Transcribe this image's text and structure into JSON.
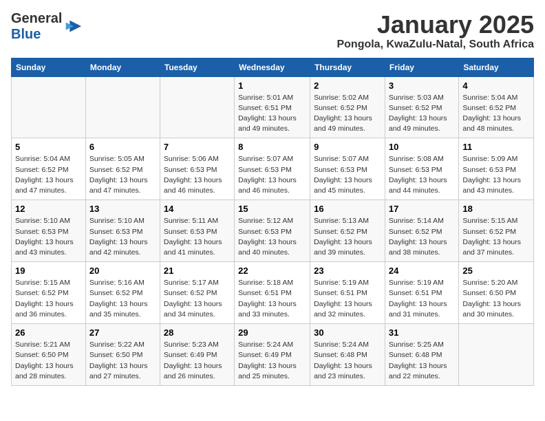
{
  "header": {
    "logo_general": "General",
    "logo_blue": "Blue",
    "month": "January 2025",
    "location": "Pongola, KwaZulu-Natal, South Africa"
  },
  "weekdays": [
    "Sunday",
    "Monday",
    "Tuesday",
    "Wednesday",
    "Thursday",
    "Friday",
    "Saturday"
  ],
  "weeks": [
    [
      {
        "day": "",
        "sunrise": "",
        "sunset": "",
        "daylight": ""
      },
      {
        "day": "",
        "sunrise": "",
        "sunset": "",
        "daylight": ""
      },
      {
        "day": "",
        "sunrise": "",
        "sunset": "",
        "daylight": ""
      },
      {
        "day": "1",
        "sunrise": "Sunrise: 5:01 AM",
        "sunset": "Sunset: 6:51 PM",
        "daylight": "Daylight: 13 hours and 49 minutes."
      },
      {
        "day": "2",
        "sunrise": "Sunrise: 5:02 AM",
        "sunset": "Sunset: 6:52 PM",
        "daylight": "Daylight: 13 hours and 49 minutes."
      },
      {
        "day": "3",
        "sunrise": "Sunrise: 5:03 AM",
        "sunset": "Sunset: 6:52 PM",
        "daylight": "Daylight: 13 hours and 49 minutes."
      },
      {
        "day": "4",
        "sunrise": "Sunrise: 5:04 AM",
        "sunset": "Sunset: 6:52 PM",
        "daylight": "Daylight: 13 hours and 48 minutes."
      }
    ],
    [
      {
        "day": "5",
        "sunrise": "Sunrise: 5:04 AM",
        "sunset": "Sunset: 6:52 PM",
        "daylight": "Daylight: 13 hours and 47 minutes."
      },
      {
        "day": "6",
        "sunrise": "Sunrise: 5:05 AM",
        "sunset": "Sunset: 6:52 PM",
        "daylight": "Daylight: 13 hours and 47 minutes."
      },
      {
        "day": "7",
        "sunrise": "Sunrise: 5:06 AM",
        "sunset": "Sunset: 6:53 PM",
        "daylight": "Daylight: 13 hours and 46 minutes."
      },
      {
        "day": "8",
        "sunrise": "Sunrise: 5:07 AM",
        "sunset": "Sunset: 6:53 PM",
        "daylight": "Daylight: 13 hours and 46 minutes."
      },
      {
        "day": "9",
        "sunrise": "Sunrise: 5:07 AM",
        "sunset": "Sunset: 6:53 PM",
        "daylight": "Daylight: 13 hours and 45 minutes."
      },
      {
        "day": "10",
        "sunrise": "Sunrise: 5:08 AM",
        "sunset": "Sunset: 6:53 PM",
        "daylight": "Daylight: 13 hours and 44 minutes."
      },
      {
        "day": "11",
        "sunrise": "Sunrise: 5:09 AM",
        "sunset": "Sunset: 6:53 PM",
        "daylight": "Daylight: 13 hours and 43 minutes."
      }
    ],
    [
      {
        "day": "12",
        "sunrise": "Sunrise: 5:10 AM",
        "sunset": "Sunset: 6:53 PM",
        "daylight": "Daylight: 13 hours and 43 minutes."
      },
      {
        "day": "13",
        "sunrise": "Sunrise: 5:10 AM",
        "sunset": "Sunset: 6:53 PM",
        "daylight": "Daylight: 13 hours and 42 minutes."
      },
      {
        "day": "14",
        "sunrise": "Sunrise: 5:11 AM",
        "sunset": "Sunset: 6:53 PM",
        "daylight": "Daylight: 13 hours and 41 minutes."
      },
      {
        "day": "15",
        "sunrise": "Sunrise: 5:12 AM",
        "sunset": "Sunset: 6:53 PM",
        "daylight": "Daylight: 13 hours and 40 minutes."
      },
      {
        "day": "16",
        "sunrise": "Sunrise: 5:13 AM",
        "sunset": "Sunset: 6:52 PM",
        "daylight": "Daylight: 13 hours and 39 minutes."
      },
      {
        "day": "17",
        "sunrise": "Sunrise: 5:14 AM",
        "sunset": "Sunset: 6:52 PM",
        "daylight": "Daylight: 13 hours and 38 minutes."
      },
      {
        "day": "18",
        "sunrise": "Sunrise: 5:15 AM",
        "sunset": "Sunset: 6:52 PM",
        "daylight": "Daylight: 13 hours and 37 minutes."
      }
    ],
    [
      {
        "day": "19",
        "sunrise": "Sunrise: 5:15 AM",
        "sunset": "Sunset: 6:52 PM",
        "daylight": "Daylight: 13 hours and 36 minutes."
      },
      {
        "day": "20",
        "sunrise": "Sunrise: 5:16 AM",
        "sunset": "Sunset: 6:52 PM",
        "daylight": "Daylight: 13 hours and 35 minutes."
      },
      {
        "day": "21",
        "sunrise": "Sunrise: 5:17 AM",
        "sunset": "Sunset: 6:52 PM",
        "daylight": "Daylight: 13 hours and 34 minutes."
      },
      {
        "day": "22",
        "sunrise": "Sunrise: 5:18 AM",
        "sunset": "Sunset: 6:51 PM",
        "daylight": "Daylight: 13 hours and 33 minutes."
      },
      {
        "day": "23",
        "sunrise": "Sunrise: 5:19 AM",
        "sunset": "Sunset: 6:51 PM",
        "daylight": "Daylight: 13 hours and 32 minutes."
      },
      {
        "day": "24",
        "sunrise": "Sunrise: 5:19 AM",
        "sunset": "Sunset: 6:51 PM",
        "daylight": "Daylight: 13 hours and 31 minutes."
      },
      {
        "day": "25",
        "sunrise": "Sunrise: 5:20 AM",
        "sunset": "Sunset: 6:50 PM",
        "daylight": "Daylight: 13 hours and 30 minutes."
      }
    ],
    [
      {
        "day": "26",
        "sunrise": "Sunrise: 5:21 AM",
        "sunset": "Sunset: 6:50 PM",
        "daylight": "Daylight: 13 hours and 28 minutes."
      },
      {
        "day": "27",
        "sunrise": "Sunrise: 5:22 AM",
        "sunset": "Sunset: 6:50 PM",
        "daylight": "Daylight: 13 hours and 27 minutes."
      },
      {
        "day": "28",
        "sunrise": "Sunrise: 5:23 AM",
        "sunset": "Sunset: 6:49 PM",
        "daylight": "Daylight: 13 hours and 26 minutes."
      },
      {
        "day": "29",
        "sunrise": "Sunrise: 5:24 AM",
        "sunset": "Sunset: 6:49 PM",
        "daylight": "Daylight: 13 hours and 25 minutes."
      },
      {
        "day": "30",
        "sunrise": "Sunrise: 5:24 AM",
        "sunset": "Sunset: 6:48 PM",
        "daylight": "Daylight: 13 hours and 23 minutes."
      },
      {
        "day": "31",
        "sunrise": "Sunrise: 5:25 AM",
        "sunset": "Sunset: 6:48 PM",
        "daylight": "Daylight: 13 hours and 22 minutes."
      },
      {
        "day": "",
        "sunrise": "",
        "sunset": "",
        "daylight": ""
      }
    ]
  ]
}
